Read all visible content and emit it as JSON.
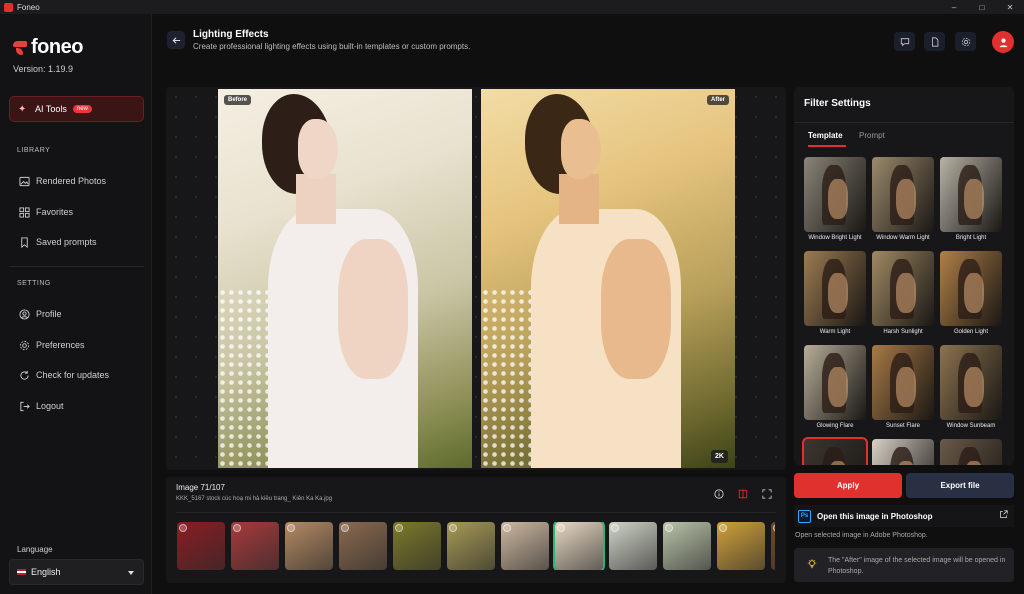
{
  "window": {
    "title": "Foneo",
    "minimize": "–",
    "maximize": "□",
    "close": "✕"
  },
  "sidebar": {
    "brand": "foneo",
    "version": "Version: 1.19.9",
    "ai_tools": {
      "label": "AI Tools",
      "badge": "new"
    },
    "library_label": "LIBRARY",
    "library_items": [
      {
        "label": "Rendered Photos",
        "icon": "image-icon"
      },
      {
        "label": "Favorites",
        "icon": "grid-icon"
      },
      {
        "label": "Saved prompts",
        "icon": "bookmark-icon"
      }
    ],
    "setting_label": "SETTING",
    "setting_items": [
      {
        "label": "Profile",
        "icon": "user-icon"
      },
      {
        "label": "Preferences",
        "icon": "gear-icon"
      },
      {
        "label": "Check for updates",
        "icon": "refresh-icon"
      },
      {
        "label": "Logout",
        "icon": "logout-icon"
      }
    ],
    "language_label": "Language",
    "language_value": "English"
  },
  "header": {
    "title": "Lighting Effects",
    "subtitle": "Create professional lighting effects using built-in templates or custom prompts."
  },
  "preview": {
    "before_tag": "Before",
    "after_tag": "After",
    "resolution_tag": "2K"
  },
  "strip": {
    "count": "Image 71/107",
    "filename": "KKK_5167 stock cúc hoạ mi hà kiều trang_ Kiên Ka Ka.jpg",
    "thumbs": [
      {
        "color": "#8a1d22"
      },
      {
        "color": "#a83a3c"
      },
      {
        "color": "#b48a63"
      },
      {
        "color": "#8c6a4f"
      },
      {
        "color": "#7c7a2a"
      },
      {
        "color": "#a79a55"
      },
      {
        "color": "#cdb8a0"
      },
      {
        "color": "#e7d8c2",
        "selected": true
      },
      {
        "color": "#cfd3c6"
      },
      {
        "color": "#b8c3a7"
      },
      {
        "color": "#d1a13a"
      },
      {
        "color": "#6d4a2a"
      }
    ]
  },
  "filter_panel": {
    "title": "Filter Settings",
    "tab_template": "Template",
    "tab_prompt": "Prompt",
    "templates": [
      {
        "name": "Window Bright Light",
        "color": "#8a8478"
      },
      {
        "name": "Window Warm Light",
        "color": "#9b8a6c"
      },
      {
        "name": "Bright Light",
        "color": "#b8b2a6"
      },
      {
        "name": "Warm Light",
        "color": "#9c7c52"
      },
      {
        "name": "Harsh Sunlight",
        "color": "#a08a64"
      },
      {
        "name": "Golden Light",
        "color": "#b08048"
      },
      {
        "name": "Glowing Flare",
        "color": "#b7ad98"
      },
      {
        "name": "Sunset Flare",
        "color": "#a87a46"
      },
      {
        "name": "Window Sunbeam",
        "color": "#8c7350"
      },
      {
        "name": "",
        "color": "#3c3530",
        "selected": true
      },
      {
        "name": "",
        "color": "#d8d2c6"
      },
      {
        "name": "",
        "color": "#6a5a48"
      }
    ]
  },
  "actions": {
    "apply": "Apply",
    "export": "Export file",
    "photoshop_icon": "Ps",
    "photoshop_title": "Open this image in Photoshop",
    "photoshop_sub": "Open selected image in Adobe Photoshop.",
    "note": "The \"After\" image of the selected image will be opened in Photoshop."
  }
}
